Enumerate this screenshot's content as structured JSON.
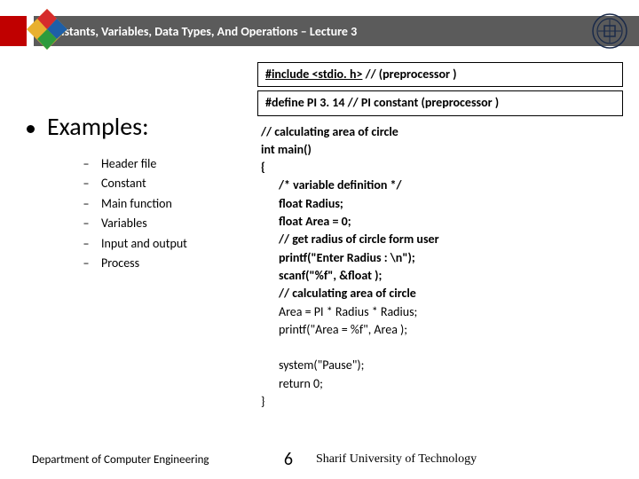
{
  "header": {
    "title": "Constants, Variables, Data Types, And Operations – Lecture 3"
  },
  "left": {
    "heading": "Examples:",
    "items": [
      "Header file",
      "Constant",
      "Main function",
      "Variables",
      "Input and output",
      "Process"
    ]
  },
  "code": {
    "box1_a": "#include <stdio. h>",
    "box1_b": " // (preprocessor )",
    "box2_a": "#define   PI    3. 14 ",
    "box2_b": " // PI  constant (preprocessor )",
    "lines": [
      {
        "t": "// calculating  area of circle",
        "b": true,
        "i": 0
      },
      {
        "t": "int main()",
        "b": true,
        "i": 0
      },
      {
        "t": "{",
        "b": true,
        "i": 0
      },
      {
        "t": "/* variable definition */",
        "b": true,
        "i": 1
      },
      {
        "t": "float Radius;",
        "b": true,
        "i": 1
      },
      {
        "t": "float  Area = 0;",
        "b": true,
        "i": 1
      },
      {
        "t": "// get radius of circle form user",
        "b": true,
        "i": 1
      },
      {
        "t": "printf(\"Enter Radius : \\n\");",
        "b": true,
        "i": 1
      },
      {
        "t": "scanf(\"%f\",  &float );",
        "b": true,
        "i": 1
      },
      {
        "t": "// calculating  area of circle",
        "b": true,
        "i": 1
      },
      {
        "t": "Area  =  PI  *  Radius  *  Radius;",
        "b": false,
        "i": 1
      },
      {
        "t": "printf(\"Area  =  %f\",  Area );",
        "b": false,
        "i": 1
      },
      {
        "t": "",
        "b": false,
        "i": 1
      },
      {
        "t": "system(\"Pause\");",
        "b": false,
        "i": 1
      },
      {
        "t": "return 0;",
        "b": false,
        "i": 1
      },
      {
        "t": "}",
        "b": false,
        "i": 0
      }
    ]
  },
  "footer": {
    "left": "Department of Computer Engineering",
    "page": "6",
    "right": "Sharif University of Technology"
  }
}
